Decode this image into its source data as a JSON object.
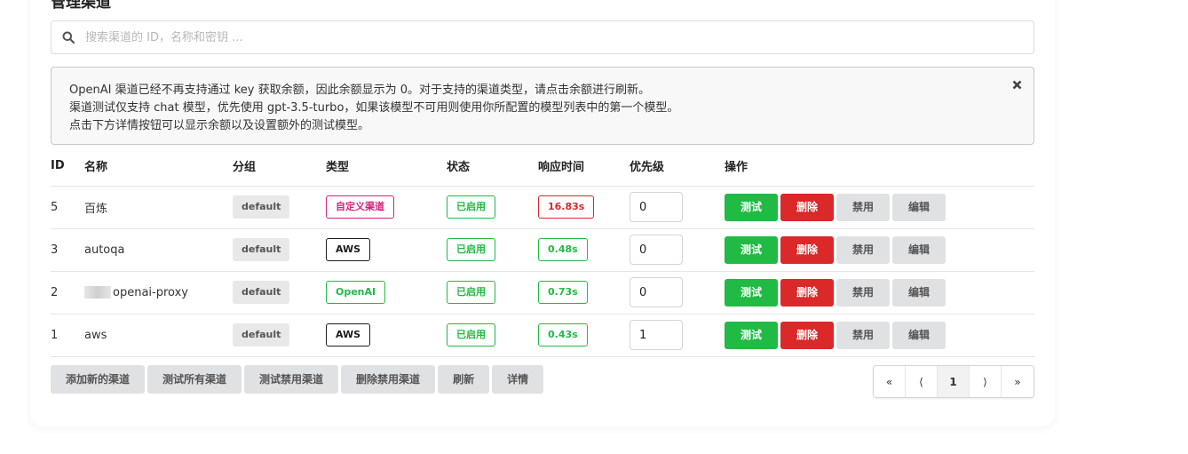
{
  "page": {
    "title": "管理渠道"
  },
  "search": {
    "placeholder": "搜索渠道的 ID，名称和密钥 ..."
  },
  "notice": {
    "lines": [
      "OpenAI 渠道已经不再支持通过 key 获取余额，因此余额显示为 0。对于支持的渠道类型，请点击余额进行刷新。",
      "渠道测试仅支持 chat 模型，优先使用 gpt-3.5-turbo，如果该模型不可用则使用你所配置的模型列表中的第一个模型。",
      "点击下方详情按钮可以显示余额以及设置额外的测试模型。"
    ]
  },
  "table": {
    "headers": {
      "id": "ID",
      "name": "名称",
      "group": "分组",
      "type": "类型",
      "status": "状态",
      "response_time": "响应时间",
      "priority": "优先级",
      "actions": "操作"
    },
    "rows": [
      {
        "id": "5",
        "name": "百炼",
        "group": "default",
        "type": "自定义渠道",
        "type_style": "pink",
        "status": "已启用",
        "response_time": "16.83s",
        "time_style": "red",
        "priority": "0"
      },
      {
        "id": "3",
        "name": "autoqa",
        "group": "default",
        "type": "AWS",
        "type_style": "black",
        "status": "已启用",
        "response_time": "0.48s",
        "time_style": "green",
        "priority": "0"
      },
      {
        "id": "2",
        "name": "openai-proxy",
        "name_redacted_prefix": true,
        "group": "default",
        "type": "OpenAI",
        "type_style": "green",
        "status": "已启用",
        "response_time": "0.73s",
        "time_style": "green",
        "priority": "0"
      },
      {
        "id": "1",
        "name": "aws",
        "group": "default",
        "type": "AWS",
        "type_style": "black",
        "status": "已启用",
        "response_time": "0.43s",
        "time_style": "green",
        "priority": "1"
      }
    ],
    "row_actions": {
      "test": "测试",
      "delete": "删除",
      "disable": "禁用",
      "edit": "编辑"
    }
  },
  "footer": {
    "add": "添加新的渠道",
    "test_all": "测试所有渠道",
    "test_disabled": "测试禁用渠道",
    "delete_disabled": "删除禁用渠道",
    "refresh": "刷新",
    "details": "详情"
  },
  "pagination": {
    "first": "«",
    "prev": "⟨",
    "current": "1",
    "next": "⟩",
    "last": "»"
  },
  "colors": {
    "green": "#21ba45",
    "red": "#db2828",
    "pink": "#d9217a",
    "grey": "#e0e1e2"
  }
}
